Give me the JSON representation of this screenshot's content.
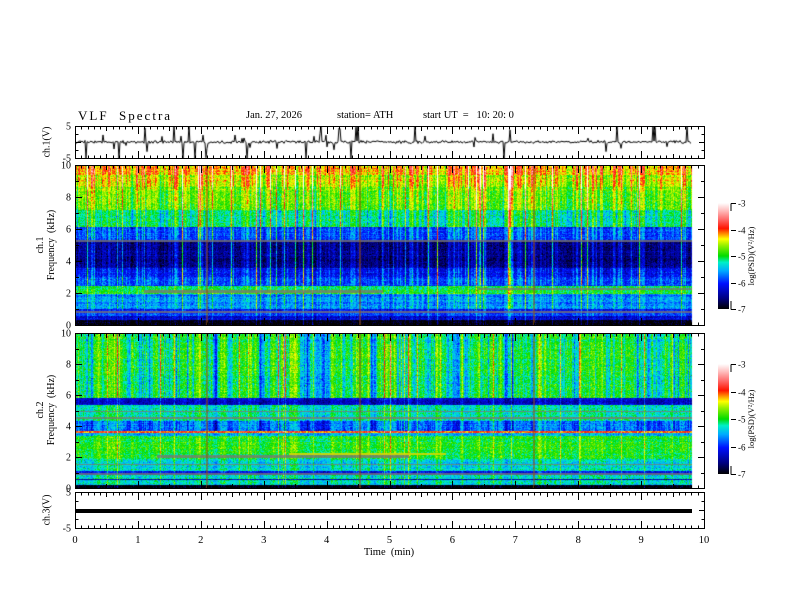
{
  "header": {
    "title": "VLF  Spectra",
    "date": "Jan. 27, 2026",
    "station": "station= ATH",
    "start_ut": "start UT  =   10: 20: 0"
  },
  "time_axis": {
    "label": "Time  (min)",
    "min": 0,
    "max": 10,
    "major_ticks": [
      0,
      1,
      2,
      3,
      4,
      5,
      6,
      7,
      8,
      9,
      10
    ],
    "minor_step": 0.1,
    "medium_step": 0.5,
    "data_end": 9.81
  },
  "colorbars": [
    {
      "label": "log(PSD)(V²/Hz)",
      "max": -3,
      "min": -7,
      "ticks": [
        -3,
        -4,
        -5,
        -6,
        -7
      ]
    },
    {
      "label": "log(PSD)(V²/Hz)",
      "max": -3,
      "min": -7,
      "ticks": [
        -3,
        -4,
        -5,
        -6,
        -7
      ]
    }
  ],
  "colormap": {
    "stops": [
      [
        0,
        "#000000"
      ],
      [
        0.1,
        "#000080"
      ],
      [
        0.24,
        "#0010FF"
      ],
      [
        0.36,
        "#00AAFF"
      ],
      [
        0.44,
        "#00F0C8"
      ],
      [
        0.5,
        "#00DC00"
      ],
      [
        0.6,
        "#96F000"
      ],
      [
        0.66,
        "#FFFF00"
      ],
      [
        0.71,
        "#FF8C00"
      ],
      [
        0.76,
        "#FF1400"
      ],
      [
        0.85,
        "#FF6E6E"
      ],
      [
        0.93,
        "#FFBEBE"
      ],
      [
        1,
        "#FFFFFF"
      ]
    ]
  },
  "colors": {
    "trace": "#000000",
    "frame": "#000000",
    "background": "#ffffff",
    "interference_gray": "#787878",
    "interference_yellow": "#d8d800",
    "interference_brown": "#96500a"
  },
  "chart_data": [
    {
      "type": "line",
      "id": "ch1-waveform",
      "ylabel": "ch.1(V)",
      "ylim": [
        -5,
        5
      ],
      "yticks_labeled": [
        5,
        -5
      ],
      "x_range_min": [
        0,
        9.81
      ],
      "description": "broadband noise ~±1 V about 0 V with frequent impulsive sferic spikes to ±5 V (clipped at panel edges)",
      "texture": {
        "noise_sigma": 0.45,
        "spike_prob": 0.085,
        "spike_amp_min": 1.2,
        "spike_amp_max": 9,
        "down_bias": 0.55
      }
    },
    {
      "type": "heatmap",
      "id": "ch1-spectrogram",
      "ylabel1": "ch.1",
      "ylabel2": "Frequency  (kHz)",
      "ylim": [
        0,
        10
      ],
      "yticks_labeled": [
        0,
        2,
        4,
        6,
        8,
        10
      ],
      "zlabel": "log(PSD)(V²/Hz)",
      "zlim": [
        -7,
        -3
      ],
      "bands": [
        [
          0,
          0.3,
          -7
        ],
        [
          0.3,
          0.55,
          -6.3
        ],
        [
          0.55,
          0.75,
          -5.9
        ],
        [
          0.75,
          1.0,
          -6.1
        ],
        [
          1.0,
          1.95,
          -5.7
        ],
        [
          1.95,
          2.45,
          -5.05
        ],
        [
          2.45,
          3.0,
          -5.9
        ],
        [
          3.0,
          3.55,
          -6.1
        ],
        [
          3.55,
          5.3,
          -6.55
        ],
        [
          5.3,
          6.1,
          -5.9
        ],
        [
          6.1,
          7.2,
          -5.15
        ],
        [
          7.2,
          8.6,
          -4.75
        ],
        [
          8.6,
          9.4,
          -4.5
        ],
        [
          9.4,
          10,
          -4.25
        ]
      ],
      "streak": {
        "smooth": 0.35,
        "amp": 0.55,
        "strong_prob": 0.06,
        "strong_amp": 1.5,
        "wpos": [
          [
            0,
            1,
            0.25
          ],
          [
            1,
            2,
            0.5
          ],
          [
            2,
            2.5,
            0.35
          ],
          [
            2.5,
            6,
            0.85
          ],
          [
            6,
            8.5,
            0.75
          ],
          [
            8.5,
            10,
            1.1
          ]
        ],
        "wneg": [
          [
            0,
            6,
            0.3
          ],
          [
            6,
            10,
            0.7
          ]
        ]
      },
      "gray_lines": [
        {
          "f": 5.3,
          "t0": 0,
          "t1": 9.81,
          "w": 2
        },
        {
          "f": 0.85,
          "t0": 0,
          "t1": 9.81,
          "w": 2
        },
        {
          "f": 2.2,
          "t0": 1.1,
          "t1": 4.9,
          "w": 3
        },
        {
          "f": 2.3,
          "t0": 6.4,
          "t1": 9.81,
          "w": 2
        }
      ],
      "yellow_lines": [],
      "vlines_t": [
        2.08,
        4.52,
        7.28
      ]
    },
    {
      "type": "heatmap",
      "id": "ch2-spectrogram",
      "ylabel1": "ch.2",
      "ylabel2": "Frequency  (kHz)",
      "ylim": [
        0,
        10
      ],
      "yticks_labeled": [
        0,
        2,
        4,
        6,
        8,
        10
      ],
      "zlabel": "log(PSD)(V²/Hz)",
      "zlim": [
        -7,
        -3
      ],
      "bands": [
        [
          0,
          0.22,
          -7
        ],
        [
          0.22,
          0.5,
          -5.3
        ],
        [
          0.5,
          0.6,
          -6.4
        ],
        [
          0.6,
          0.85,
          -5.35
        ],
        [
          0.85,
          1.1,
          -6.15
        ],
        [
          1.1,
          1.9,
          -5.35
        ],
        [
          1.9,
          2.3,
          -5.0
        ],
        [
          2.3,
          3.35,
          -4.95
        ],
        [
          3.35,
          3.52,
          -5.5
        ],
        [
          3.52,
          3.68,
          -4.05
        ],
        [
          3.68,
          4.35,
          -5.7
        ],
        [
          4.35,
          5.35,
          -5.25
        ],
        [
          5.35,
          5.8,
          -6.3
        ],
        [
          5.8,
          10,
          -5.05
        ]
      ],
      "streak": {
        "smooth": 0.62,
        "amp": 0.5,
        "strong_prob": 0.05,
        "strong_amp": 1.2,
        "wpos": [
          [
            0.2,
            5.4,
            0.45
          ],
          [
            5.8,
            10,
            0.7
          ]
        ],
        "wneg": [
          [
            0,
            3.7,
            0.25
          ],
          [
            3.7,
            4.4,
            0.8
          ],
          [
            5.8,
            10,
            1.1
          ]
        ]
      },
      "gray_lines": [
        {
          "f": 4.6,
          "t0": 0,
          "t1": 9.81,
          "w": 2
        },
        {
          "f": 5.0,
          "t0": 0,
          "t1": 9.81,
          "w": 1
        },
        {
          "f": 2.1,
          "t0": 1.3,
          "t1": 5.3,
          "w": 3
        },
        {
          "f": 1.55,
          "t0": 0,
          "t1": 9.81,
          "w": 1
        },
        {
          "f": 0.95,
          "t0": 0,
          "t1": 9.81,
          "w": 2
        }
      ],
      "yellow_lines": [
        {
          "f": 2.25,
          "t0": 3.4,
          "t1": 5.9,
          "w": 2
        }
      ],
      "vlines_t": [
        2.08,
        4.52,
        7.28
      ]
    },
    {
      "type": "line",
      "id": "ch3-flatline",
      "ylabel": "ch.3(V)",
      "ylim": [
        -5,
        5
      ],
      "yticks_labeled": [
        5,
        -5
      ],
      "x_range_min": [
        0,
        9.81
      ],
      "value": 0,
      "description": "flat saturated trace at 0 V for full record"
    }
  ]
}
